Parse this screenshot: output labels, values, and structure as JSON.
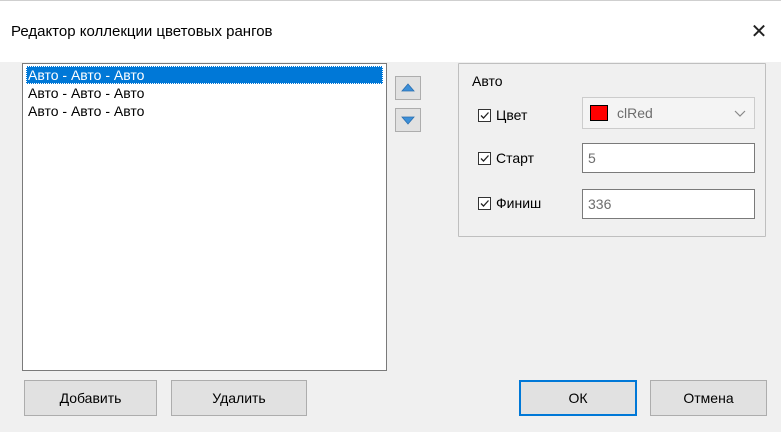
{
  "window": {
    "title": "Редактор коллекции цветовых рангов",
    "close_glyph": "✕"
  },
  "list": {
    "items": [
      {
        "label": "Авто - Авто - Авто",
        "selected": true
      },
      {
        "label": "Авто - Авто - Авто",
        "selected": false
      },
      {
        "label": "Авто - Авто - Авто",
        "selected": false
      }
    ]
  },
  "group": {
    "title": "Авто",
    "color": {
      "label": "Цвет",
      "checked": true,
      "value": "clRed",
      "swatch": "#ff0000"
    },
    "start": {
      "label": "Старт",
      "checked": true,
      "value": "5"
    },
    "finish": {
      "label": "Финиш",
      "checked": true,
      "value": "336"
    }
  },
  "buttons": {
    "add": "Добавить",
    "delete": "Удалить",
    "ok": "ОК",
    "cancel": "Отмена"
  },
  "colors": {
    "accent": "#0078d7",
    "arrow": "#3c8fd8"
  }
}
